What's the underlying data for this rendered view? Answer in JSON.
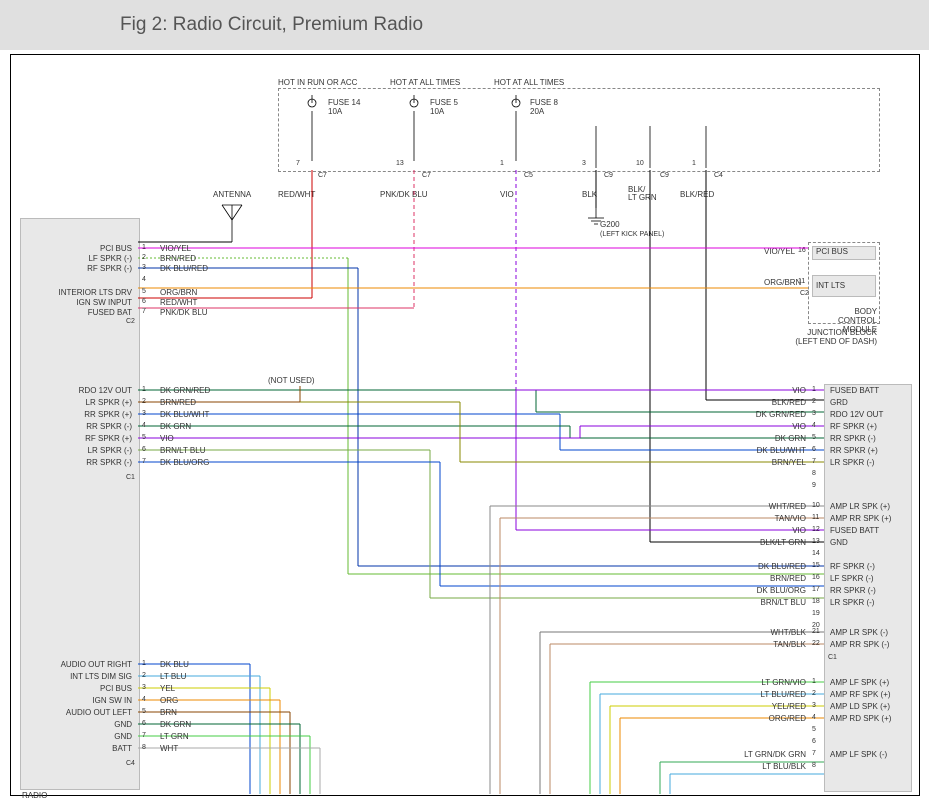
{
  "title": "Fig 2: Radio Circuit, Premium Radio",
  "top_labels": {
    "hot_run": "HOT IN RUN OR ACC",
    "hot_all1": "HOT AT ALL TIMES",
    "hot_all2": "HOT AT ALL TIMES"
  },
  "fuses": {
    "f14": {
      "name": "FUSE 14",
      "rating": "10A"
    },
    "f5": {
      "name": "FUSE 5",
      "rating": "10A"
    },
    "f8": {
      "name": "FUSE 8",
      "rating": "20A"
    }
  },
  "fuse_wires": {
    "red_wht": "RED/WHT",
    "pnk_dkblu": "PNK/DK BLU",
    "vio": "VIO",
    "blk": "BLK",
    "blk_ltgrn": "BLK/\nLT GRN",
    "blk_red": "BLK/RED"
  },
  "fuse_pins": {
    "c7": "C7",
    "c7b": "C7",
    "c5": "C5",
    "c9a": "C9",
    "c9b": "C9",
    "c4": "C4",
    "p7": "7",
    "p13": "13",
    "p1": "1",
    "p3": "3",
    "p10": "10",
    "p1b": "1"
  },
  "antenna": "ANTENNA",
  "g200": {
    "name": "G200",
    "desc": "(LEFT KICK\nPANEL)"
  },
  "not_used": "(NOT USED)",
  "junction_block": {
    "l1": "JUNCTION BLOCK",
    "l2": "(LEFT END OF DASH)"
  },
  "bcm": {
    "l1": "BODY",
    "l2": "CONTROL",
    "l3": "MODULE"
  },
  "radio_label": "RADIO",
  "left_block": {
    "c2": {
      "labels": [
        "PCI BUS",
        "LF SPKR (-)",
        "RF SPKR (-)",
        "",
        "INTERIOR LTS DRV",
        "IGN SW INPUT",
        "FUSED BAT"
      ],
      "wires": [
        "VIO/YEL",
        "BRN/RED",
        "DK BLU/RED",
        "",
        "ORG/BRN",
        "RED/WHT",
        "PNK/DK BLU"
      ],
      "conn": "C2"
    },
    "c1": {
      "labels": [
        "RDO 12V OUT",
        "LR SPKR (+)",
        "RR SPKR (+)",
        "RR SPKR (-)",
        "RF SPKR (+)",
        "LR SPKR (-)",
        "RR SPKR (-)"
      ],
      "wires": [
        "DK GRN/RED",
        "BRN/RED",
        "DK BLU/WHT",
        "DK GRN",
        "VIO",
        "BRN/LT BLU",
        "DK BLU/ORG"
      ],
      "conn": "C1"
    },
    "c4": {
      "labels": [
        "AUDIO OUT RIGHT",
        "INT LTS DIM SIG",
        "PCI BUS",
        "IGN SW IN",
        "AUDIO OUT LEFT",
        "GND",
        "GND",
        "BATT"
      ],
      "wires": [
        "DK BLU",
        "LT BLU",
        "YEL",
        "ORG",
        "BRN",
        "DK GRN",
        "LT GRN",
        "WHT"
      ],
      "conn": "C4"
    }
  },
  "right_block": {
    "bus": {
      "vioyel": "VIO/YEL",
      "orgbrn": "ORG/BRN",
      "pci": "PCI BUS",
      "intlts": "INT LTS",
      "c2": "C2",
      "p16": "16",
      "p11": "11"
    },
    "c1_a": {
      "wires": [
        "VIO",
        "BLK/RED",
        "DK GRN/RED",
        "VIO",
        "DK GRN",
        "DK BLU/WHT",
        "BRN/YEL"
      ],
      "labels": [
        "FUSED BATT",
        "GRD",
        "RDO 12V OUT",
        "RF SPKR (+)",
        "RR SPKR (-)",
        "RR SPKR (+)",
        "LR SPKR (-)"
      ],
      "pins": [
        "1",
        "2",
        "3",
        "4",
        "5",
        "6",
        "7"
      ],
      "extra_pins": [
        "8",
        "9"
      ]
    },
    "c1_b": {
      "wires": [
        "WHT/RED",
        "TAN/VIO",
        "VIO",
        "BLK/LT GRN",
        "",
        "DK BLU/RED",
        "BRN/RED",
        "DK BLU/ORG",
        "BRN/LT BLU"
      ],
      "labels": [
        "AMP LR SPK (+)",
        "AMP RR SPK (+)",
        "FUSED BATT",
        "GND",
        "",
        "RF SPKR (-)",
        "LF SPKR (-)",
        "RR SPKR (-)",
        "LR SPKR (-)"
      ],
      "pins": [
        "10",
        "11",
        "12",
        "13",
        "14",
        "15",
        "16",
        "17",
        "18"
      ],
      "extra_pins": [
        "19",
        "20"
      ]
    },
    "c1_c": {
      "wires": [
        "WHT/BLK",
        "TAN/BLK"
      ],
      "labels": [
        "AMP LR SPK (-)",
        "AMP RR SPK (-)"
      ],
      "pins": [
        "21",
        "22"
      ],
      "conn": "C1"
    },
    "c2": {
      "wires": [
        "LT GRN/VIO",
        "LT BLU/RED",
        "YEL/RED",
        "ORG/RED"
      ],
      "labels": [
        "AMP LF SPK (+)",
        "AMP RF SPK (+)",
        "AMP LD SPK (+)",
        "AMP RD SPK (+)"
      ],
      "pins": [
        "1",
        "2",
        "3",
        "4"
      ],
      "extra_pins": [
        "5",
        "6"
      ]
    },
    "c2b": {
      "wires": [
        "LT GRN/DK GRN",
        "LT BLU/BLK"
      ],
      "labels": [
        "AMP LF SPK (-)",
        ""
      ],
      "pins": [
        "7",
        "8"
      ]
    }
  }
}
